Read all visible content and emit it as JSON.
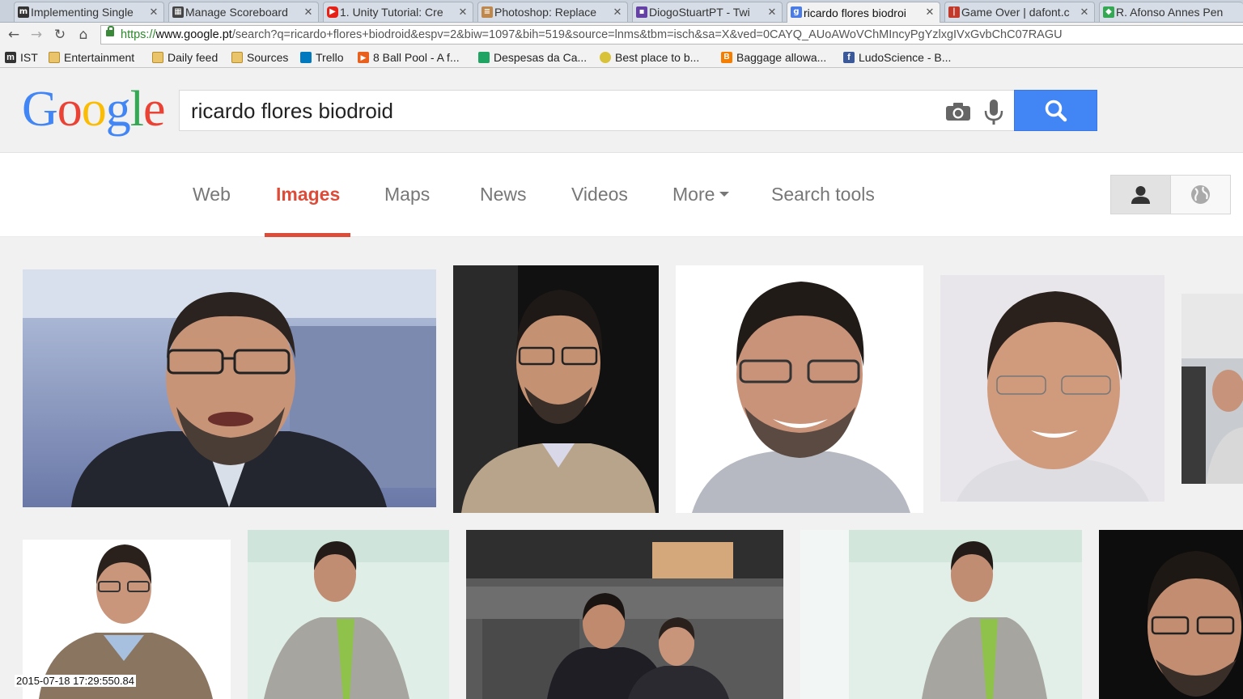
{
  "browser": {
    "tabs": [
      {
        "title": "Implementing Single",
        "icon": "medium-icon",
        "color": "#333333"
      },
      {
        "title": "Manage Scoreboard",
        "icon": "scoreboard-icon",
        "color": "#3a3a3a"
      },
      {
        "title": "1. Unity Tutorial: Cre",
        "icon": "youtube-icon",
        "color": "#e62117"
      },
      {
        "title": "Photoshop: Replace",
        "icon": "doc-icon",
        "color": "#c0874a"
      },
      {
        "title": "DiogoStuartPT - Twi",
        "icon": "twitch-icon",
        "color": "#6441a5"
      },
      {
        "title": "ricardo flores biodroi",
        "icon": "google-icon",
        "color": "#4a7ce8"
      },
      {
        "title": "Game Over | dafont.c",
        "icon": "dafont-icon",
        "color": "#c0392b"
      },
      {
        "title": "R. Afonso Annes Pen",
        "icon": "maps-icon",
        "color": "#34a853"
      }
    ],
    "url": {
      "protocol": "https://",
      "host": "www.google.pt",
      "path": "/search?q=ricardo+flores+biodroid&espv=2&biw=1097&bih=519&source=lnms&tbm=isch&sa=X&ved=0CAYQ_AUoAWoVChMIncyPgYzlxgIVxGvbChC07RAGU"
    },
    "bookmarks": [
      {
        "label": "IST",
        "icon": "m-icon"
      },
      {
        "label": "Entertainment",
        "icon": "folder-icon"
      },
      {
        "label": "Daily feed",
        "icon": "folder-icon"
      },
      {
        "label": "Sources",
        "icon": "folder-icon"
      },
      {
        "label": "Trello",
        "icon": "trello-icon"
      },
      {
        "label": "8 Ball Pool - A f...",
        "icon": "play-icon"
      },
      {
        "label": "Despesas da Ca...",
        "icon": "sheets-icon"
      },
      {
        "label": "Best place to b...",
        "icon": "smiley-icon"
      },
      {
        "label": "Baggage allowa...",
        "icon": "blogger-icon"
      },
      {
        "label": "LudoScience - B...",
        "icon": "facebook-icon"
      }
    ]
  },
  "google": {
    "logo": "Google",
    "query": "ricardo flores biodroid",
    "nav": [
      "Web",
      "Images",
      "Maps",
      "News",
      "Videos",
      "More",
      "Search tools"
    ],
    "selected_tab": "Images",
    "accent": "#dd4b39",
    "search_button_color": "#4285f4"
  },
  "overlay": {
    "timestamp": "2015-07-18 17:29:550.84"
  }
}
